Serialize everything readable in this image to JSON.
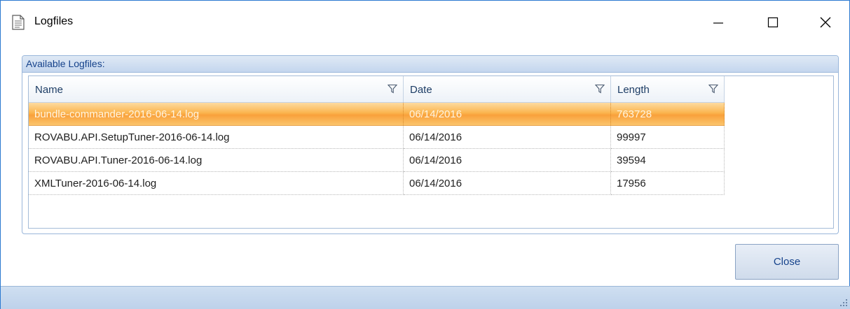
{
  "window": {
    "title": "Logfiles",
    "icon": "document-icon",
    "controls": [
      "minimize-icon",
      "maximize-icon",
      "close-icon"
    ]
  },
  "group": {
    "title": "Available Logfiles:"
  },
  "grid": {
    "columns": [
      "Name",
      "Date",
      "Length"
    ],
    "rows": [
      {
        "name": "bundle-commander-2016-06-14.log",
        "date": "06/14/2016",
        "length": "763728",
        "selected": true
      },
      {
        "name": "ROVABU.API.SetupTuner-2016-06-14.log",
        "date": "06/14/2016",
        "length": "99997",
        "selected": false
      },
      {
        "name": "ROVABU.API.Tuner-2016-06-14.log",
        "date": "06/14/2016",
        "length": "39594",
        "selected": false
      },
      {
        "name": "XMLTuner-2016-06-14.log",
        "date": "06/14/2016",
        "length": "17956",
        "selected": false
      }
    ]
  },
  "buttons": {
    "close_label": "Close"
  },
  "colors": {
    "accent": "#15428b",
    "selection": "#f9a13b",
    "window_border": "#2b79d0"
  }
}
